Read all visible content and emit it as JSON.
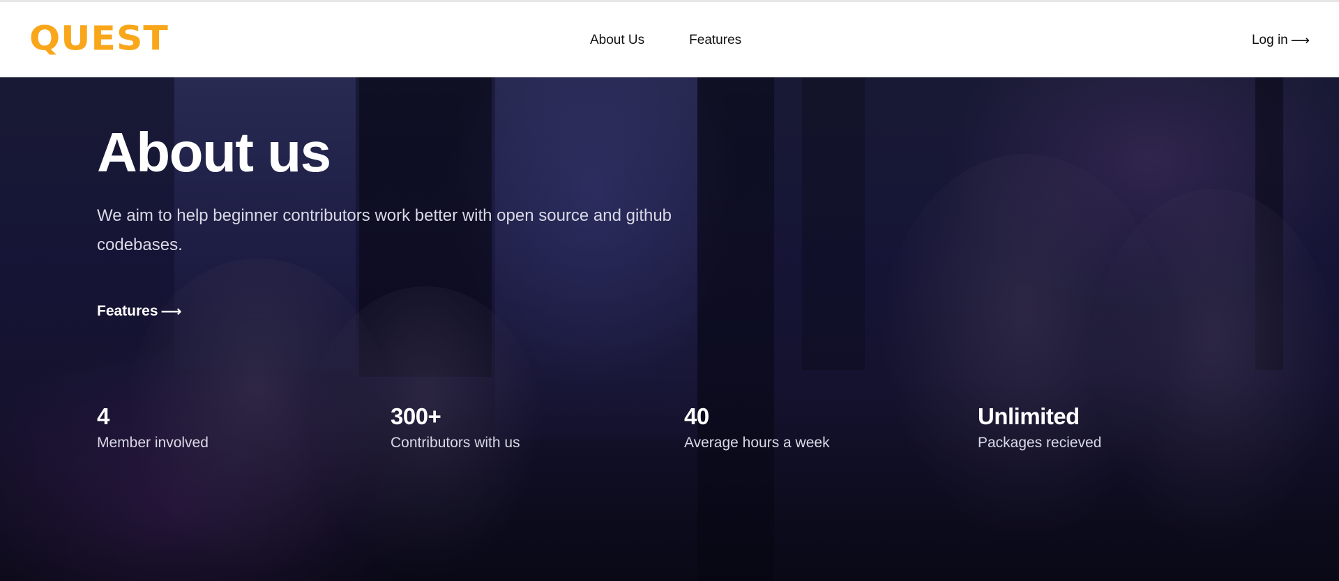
{
  "header": {
    "logo_text": "QUEST",
    "nav": [
      {
        "label": "About Us"
      },
      {
        "label": "Features"
      }
    ],
    "login_label": "Log in",
    "login_arrow": "⟶"
  },
  "hero": {
    "title": "About us",
    "description": "We aim to help beginner contributors work better with open source and github codebases.",
    "features_link": "Features",
    "features_arrow": "⟶",
    "stats": [
      {
        "value": "4",
        "label": "Member involved"
      },
      {
        "value": "300+",
        "label": "Contributors with us"
      },
      {
        "value": "40",
        "label": "Average hours a week"
      },
      {
        "value": "Unlimited",
        "label": "Packages recieved"
      }
    ]
  },
  "colors": {
    "brand": "#F9A61A",
    "hero_bg": "#17163a",
    "text_on_dark": "#ffffff"
  }
}
